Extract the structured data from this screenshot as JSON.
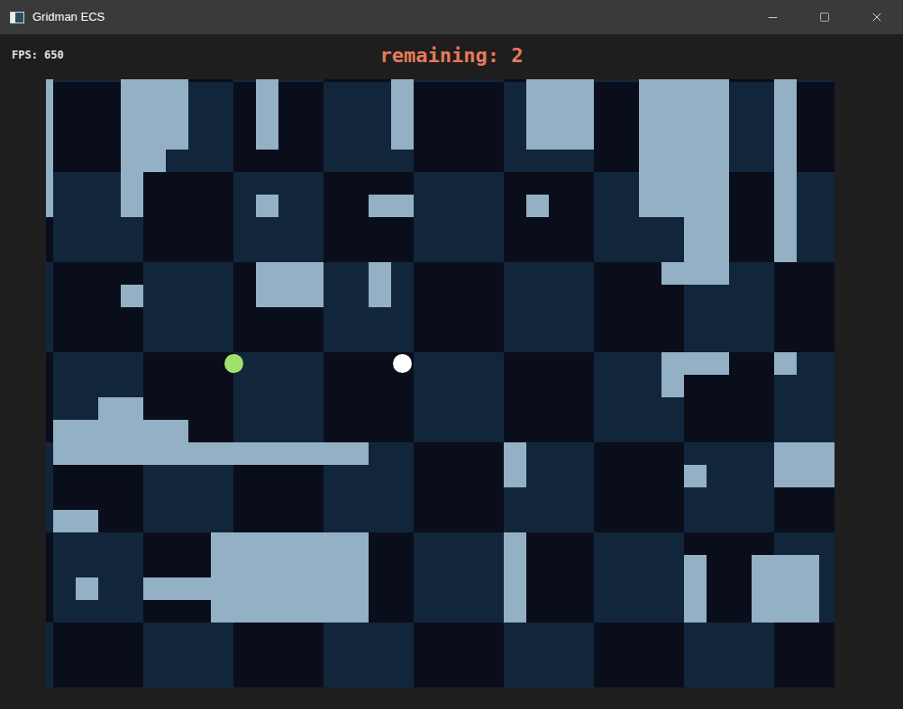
{
  "window": {
    "title": "Gridman ECS"
  },
  "hud": {
    "fps": "FPS: 650",
    "remaining": "remaining: 2"
  },
  "walls": [
    {
      "x": 3,
      "y": 3,
      "w": 1,
      "h": 7
    },
    {
      "x": 7,
      "y": 3,
      "w": 3,
      "h": 4
    },
    {
      "x": 7,
      "y": 7,
      "w": 2,
      "h": 1
    },
    {
      "x": 7,
      "y": 8,
      "w": 1,
      "h": 2
    },
    {
      "x": 13,
      "y": 3,
      "w": 1,
      "h": 4
    },
    {
      "x": 19,
      "y": 3,
      "w": 1,
      "h": 4
    },
    {
      "x": 25,
      "y": 3,
      "w": 3,
      "h": 4
    },
    {
      "x": 30,
      "y": 3,
      "w": 4,
      "h": 7
    },
    {
      "x": 32,
      "y": 10,
      "w": 2,
      "h": 2
    },
    {
      "x": 31,
      "y": 12,
      "w": 3,
      "h": 1
    },
    {
      "x": 36,
      "y": 3,
      "w": 1,
      "h": 9
    },
    {
      "x": 13,
      "y": 9,
      "w": 1,
      "h": 1
    },
    {
      "x": 18,
      "y": 9,
      "w": 2,
      "h": 1
    },
    {
      "x": 25,
      "y": 9,
      "w": 1,
      "h": 1
    },
    {
      "x": 13,
      "y": 12,
      "w": 3,
      "h": 2
    },
    {
      "x": 18,
      "y": 12,
      "w": 1,
      "h": 2
    },
    {
      "x": 7,
      "y": 13,
      "w": 1,
      "h": 1
    },
    {
      "x": 31,
      "y": 16,
      "w": 3,
      "h": 1
    },
    {
      "x": 31,
      "y": 17,
      "w": 1,
      "h": 1
    },
    {
      "x": 36,
      "y": 16,
      "w": 1,
      "h": 1
    },
    {
      "x": 6,
      "y": 18,
      "w": 2,
      "h": 1
    },
    {
      "x": 4,
      "y": 19,
      "w": 6,
      "h": 1
    },
    {
      "x": 4,
      "y": 20,
      "w": 14,
      "h": 1
    },
    {
      "x": 24,
      "y": 20,
      "w": 1,
      "h": 2
    },
    {
      "x": 36,
      "y": 20,
      "w": 3,
      "h": 2
    },
    {
      "x": 32,
      "y": 21,
      "w": 1,
      "h": 1
    },
    {
      "x": 4,
      "y": 23,
      "w": 2,
      "h": 1
    },
    {
      "x": 11,
      "y": 24,
      "w": 7,
      "h": 4
    },
    {
      "x": 8,
      "y": 26,
      "w": 3,
      "h": 1
    },
    {
      "x": 5,
      "y": 26,
      "w": 1,
      "h": 1
    },
    {
      "x": 24,
      "y": 24,
      "w": 1,
      "h": 4
    },
    {
      "x": 32,
      "y": 25,
      "w": 1,
      "h": 3
    },
    {
      "x": 35,
      "y": 25,
      "w": 3,
      "h": 3
    }
  ],
  "entities": [
    {
      "kind": "player",
      "color": "#a3e06a",
      "x": 12,
      "y": 16.5
    },
    {
      "kind": "ghost",
      "color": "#ffffff",
      "x": 19.5,
      "y": 16.5
    }
  ]
}
